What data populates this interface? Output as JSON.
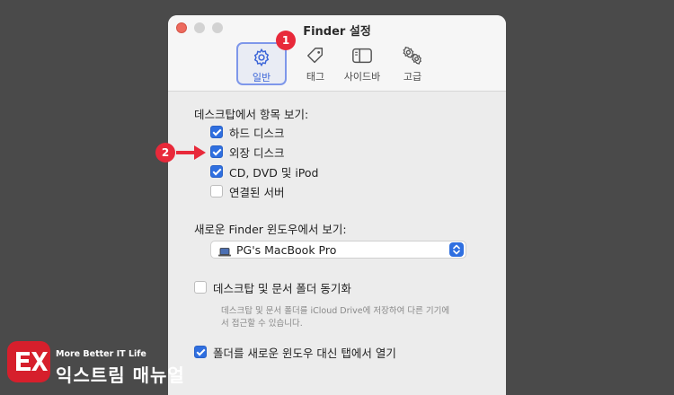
{
  "window": {
    "title": "Finder 설정"
  },
  "tabs": [
    {
      "label": "일반",
      "icon": "gear-icon",
      "active": true
    },
    {
      "label": "태그",
      "icon": "tag-icon"
    },
    {
      "label": "사이드바",
      "icon": "sidebar-icon"
    },
    {
      "label": "고급",
      "icon": "gears-icon"
    }
  ],
  "annotations": {
    "badge1": "1",
    "badge2": "2"
  },
  "desktop_section": {
    "label": "데스크탑에서 항목 보기:",
    "items": [
      {
        "label": "하드 디스크",
        "checked": true
      },
      {
        "label": "외장 디스크",
        "checked": true
      },
      {
        "label": "CD, DVD 및 iPod",
        "checked": true
      },
      {
        "label": "연결된 서버",
        "checked": false
      }
    ]
  },
  "new_window": {
    "label": "새로운 Finder 윈도우에서 보기:",
    "selected": "PG's MacBook Pro",
    "icon": "laptop-icon"
  },
  "icloud": {
    "label": "데스크탑 및 문서 폴더 동기화",
    "checked": false,
    "note": "데스크탑 및 문서 폴더를 iCloud Drive에 저장하여 다른 기기에서 접근할 수 있습니다."
  },
  "open_folders": {
    "label": "폴더를 새로운 윈도우 대신 탭에서 열기",
    "checked": true
  },
  "watermark": {
    "subtitle": "More Better IT Life",
    "title": "익스트림 매뉴얼"
  },
  "colors": {
    "accent": "#2f6fe0",
    "badge": "#e8293a",
    "arrow": "#e8293a",
    "close": "#ed6a5e",
    "logo": "#d61f2c"
  }
}
